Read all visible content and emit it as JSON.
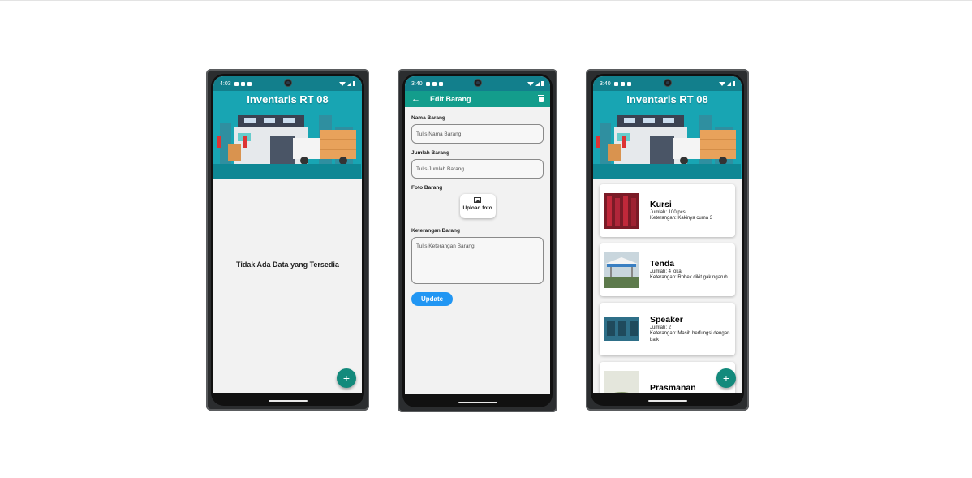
{
  "phones": [
    {
      "status": {
        "time": "4:03"
      },
      "banner_title": "Inventaris RT 08",
      "empty_message": "Tidak Ada Data yang Tersedia",
      "fab_label": "+"
    },
    {
      "status": {
        "time": "3:40"
      },
      "appbar": {
        "back_icon": "←",
        "title": "Edit Barang"
      },
      "form": {
        "name_label": "Nama Barang",
        "name_placeholder": "Tulis Nama Barang",
        "qty_label": "Jumlah Barang",
        "qty_placeholder": "Tulis Jumlah Barang",
        "photo_label": "Foto Barang",
        "upload_label": "Upload foto",
        "desc_label": "Keterangan Barang",
        "desc_placeholder": "Tulis Keterangan Barang",
        "update_button": "Update"
      }
    },
    {
      "status": {
        "time": "3:40"
      },
      "banner_title": "Inventaris RT 08",
      "fab_label": "+",
      "items": [
        {
          "name": "Kursi",
          "qty": "Jumlah: 100 pcs",
          "desc": "Keterangan: Kakinya cuma 3"
        },
        {
          "name": "Tenda",
          "qty": "Jumlah: 4 lokal",
          "desc": "Keterangan: Robek dikit gak ngaruh"
        },
        {
          "name": "Speaker",
          "qty": "Jumlah: 2",
          "desc": "Keterangan: Masih berfungsi dengan baik"
        },
        {
          "name": "Prasmanan",
          "qty": "",
          "desc": ""
        }
      ]
    }
  ],
  "colors": {
    "teal_appbar": "#139d8c",
    "banner_bg": "#18a5b3",
    "fab": "#138a7c",
    "update_button": "#2196f3"
  }
}
